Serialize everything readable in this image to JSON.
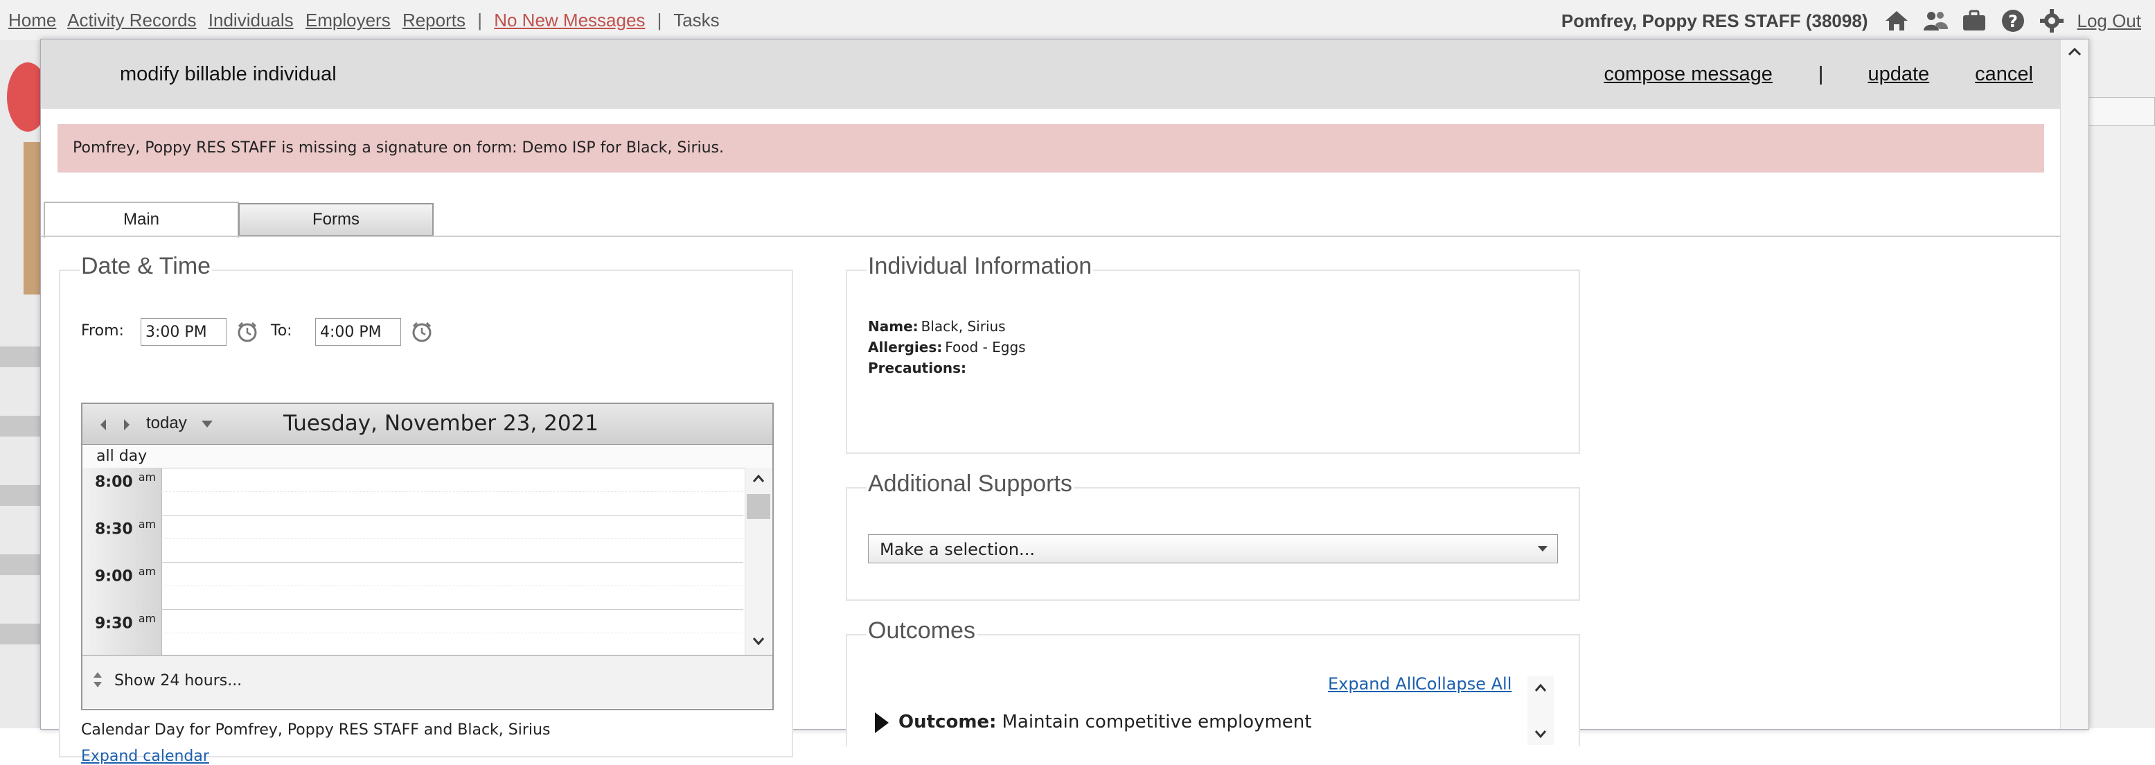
{
  "nav": {
    "items": [
      "Home",
      "Activity Records",
      "Individuals",
      "Employers",
      "Reports"
    ],
    "sep1": "|",
    "messages": "No New Messages",
    "sep2": "|",
    "tasks": "Tasks",
    "user": "Pomfrey, Poppy RES STAFF  (38098)",
    "logout": "Log Out",
    "icons": [
      "home-icon",
      "people-icon",
      "briefcase-icon",
      "help-icon",
      "gear-icon"
    ]
  },
  "modal": {
    "title": "modify billable individual",
    "actions": {
      "compose": "compose message",
      "sep": "|",
      "update": "update",
      "cancel": "cancel"
    },
    "alert": "Pomfrey, Poppy RES STAFF is missing a signature on form: Demo ISP for Black, Sirius.",
    "tabs": {
      "main": "Main",
      "forms": "Forms"
    }
  },
  "datetime": {
    "legend": "Date & Time",
    "from_label": "From:",
    "from_value": "3:00 PM",
    "to_label": "To:",
    "to_value": "4:00 PM",
    "calendar": {
      "today": "today",
      "date": "Tuesday, November 23, 2021",
      "allday": "all day",
      "slots": [
        {
          "time": "8:00",
          "ampm": "am"
        },
        {
          "time": "8:30",
          "ampm": "am"
        },
        {
          "time": "9:00",
          "ampm": "am"
        },
        {
          "time": "9:30",
          "ampm": "am"
        }
      ],
      "show24": "Show 24 hours..."
    },
    "caption": "Calendar Day for Pomfrey, Poppy RES STAFF and Black, Sirius",
    "expand": "Expand calendar"
  },
  "individual": {
    "legend": "Individual Information",
    "name_label": "Name:",
    "name": "Black, Sirius",
    "allergies_label": "Allergies:",
    "allergies": "Food - Eggs",
    "precautions_label": "Precautions:"
  },
  "supports": {
    "legend": "Additional Supports",
    "placeholder": "Make a selection..."
  },
  "outcomes": {
    "legend": "Outcomes",
    "expand_all": "Expand All",
    "collapse_all": "Collapse All",
    "label": "Outcome:",
    "value": "Maintain competitive employment"
  },
  "colors": {
    "alert_bg": "#ecc9c9",
    "link": "#1b5fae",
    "messages": "#c0504d"
  }
}
